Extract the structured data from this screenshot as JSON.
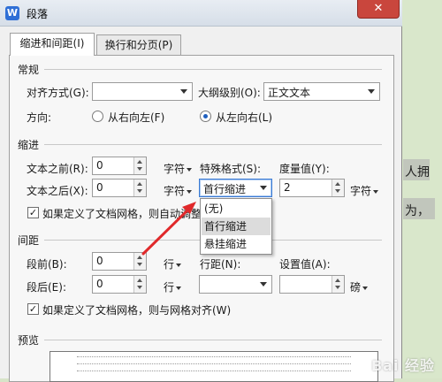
{
  "window": {
    "title": "段落",
    "app_icon_letter": "W",
    "close_label": "✕"
  },
  "tabs": [
    {
      "label": "缩进和间距(I)",
      "active": true
    },
    {
      "label": "换行和分页(P)",
      "active": false
    }
  ],
  "general": {
    "section_title": "常规",
    "alignment_label": "对齐方式(G):",
    "alignment_value": "",
    "outline_label": "大纲级别(O):",
    "outline_value": "正文文本",
    "direction_label": "方向:",
    "direction_options": [
      {
        "label": "从右向左(F)",
        "selected": false
      },
      {
        "label": "从左向右(L)",
        "selected": true
      }
    ]
  },
  "indent": {
    "section_title": "缩进",
    "before_label": "文本之前(R):",
    "before_value": "0",
    "before_unit": "字符",
    "after_label": "文本之后(X):",
    "after_value": "0",
    "after_unit": "字符",
    "special_label": "特殊格式(S):",
    "special_value": "首行缩进",
    "measure_label": "度量值(Y):",
    "measure_value": "2",
    "measure_unit": "字符",
    "auto_adjust_label": "如果定义了文档网格，则自动调整",
    "auto_adjust_checked": true,
    "special_options": [
      {
        "label": "(无)",
        "selected": false
      },
      {
        "label": "首行缩进",
        "selected": true
      },
      {
        "label": "悬挂缩进",
        "selected": false
      }
    ]
  },
  "spacing": {
    "section_title": "间距",
    "before_label": "段前(B):",
    "before_value": "0",
    "before_unit": "行",
    "after_label": "段后(E):",
    "after_value": "0",
    "after_unit": "行",
    "line_label": "行距(N):",
    "line_value": "",
    "setting_label": "设置值(A):",
    "setting_value": "",
    "setting_unit": "磅",
    "snap_grid_label": "如果定义了文档网格，则与网格对齐(W)",
    "snap_grid_checked": true
  },
  "preview": {
    "section_title": "预览"
  },
  "background_doc": {
    "line1": "人拥",
    "line2": "为，"
  },
  "watermark": "Bai 经验",
  "colors": {
    "accent": "#3b7bd4",
    "arrow": "#e0292b",
    "close": "#c9463d"
  }
}
